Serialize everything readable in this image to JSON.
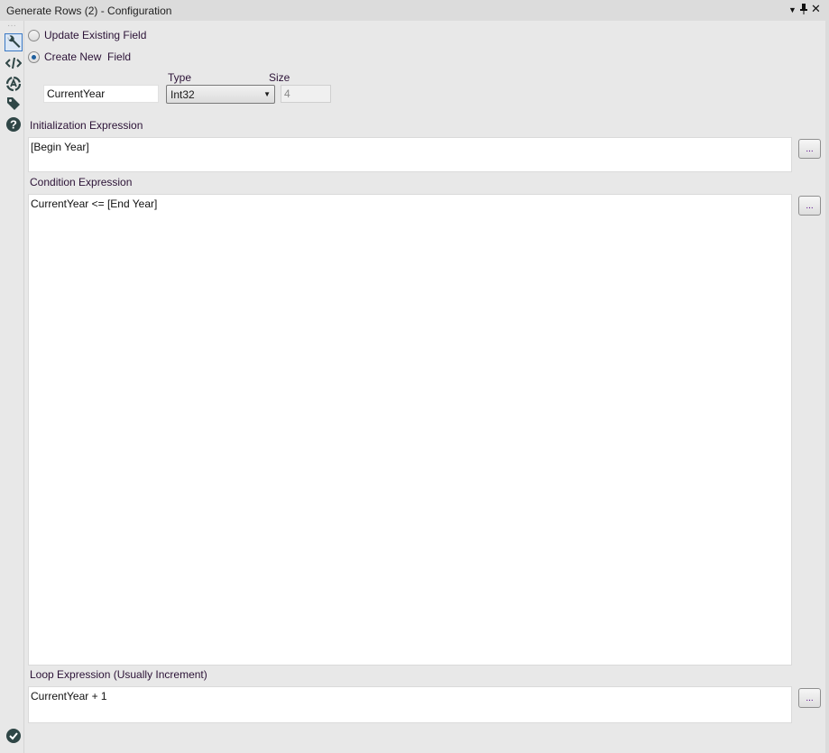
{
  "window": {
    "title": "Generate Rows (2) - Configuration",
    "menu_icon": "dropdown-arrow",
    "pin_icon": "pin",
    "close_icon": "close"
  },
  "sidebar": {
    "icons": [
      "more-dots",
      "wrench",
      "code",
      "target",
      "tag",
      "help",
      "check-circle"
    ],
    "selected": "wrench"
  },
  "mode": {
    "options": [
      {
        "label": "Update Existing Field",
        "selected": false
      },
      {
        "label": "Create New  Field",
        "selected": true
      }
    ]
  },
  "field": {
    "name": "CurrentYear",
    "type_label": "Type",
    "type_value": "Int32",
    "size_label": "Size",
    "size_value": "4"
  },
  "init": {
    "label": "Initialization Expression",
    "value": "[Begin Year]",
    "button": "..."
  },
  "condition": {
    "label": "Condition Expression",
    "value": "CurrentYear <= [End Year]",
    "button": "..."
  },
  "loop": {
    "label": "Loop Expression (Usually Increment)",
    "value": "CurrentYear + 1",
    "button": "..."
  },
  "colors": {
    "icon": "#2f4646",
    "label": "#2b1236",
    "accent": "#1e5f9e"
  }
}
